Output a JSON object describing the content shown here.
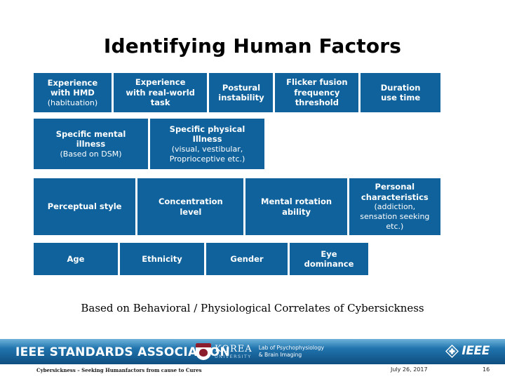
{
  "slide": {
    "title": "Identifying Human Factors",
    "caption": "Based on Behavioral / Physiological Correlates of Cybersickness"
  },
  "diagram": {
    "accent_color": "#0F629B",
    "rows": [
      {
        "id": "row-1",
        "cells": [
          {
            "main": "Experience\nwith HMD",
            "sub": "(habituation)"
          },
          {
            "main": "Experience\nwith real-world\ntask",
            "sub": ""
          },
          {
            "main": "Postural\ninstability",
            "sub": ""
          },
          {
            "main": "Flicker fusion\nfrequency\nthreshold",
            "sub": ""
          },
          {
            "main": "Duration\nuse time",
            "sub": ""
          }
        ]
      },
      {
        "id": "row-2",
        "cells": [
          {
            "main": "Specific mental\nillness",
            "sub": "(Based on DSM)"
          },
          {
            "main": "Specific physical\nIllness",
            "sub": "(visual, vestibular,\nProprioceptive etc.)"
          }
        ]
      },
      {
        "id": "row-3",
        "cells": [
          {
            "main": "Perceptual style",
            "sub": ""
          },
          {
            "main": "Concentration\nlevel",
            "sub": ""
          },
          {
            "main": "Mental rotation\nability",
            "sub": ""
          },
          {
            "main": "Personal\ncharacteristics",
            "sub": "(addiction,\nsensation seeking\netc.)"
          }
        ]
      },
      {
        "id": "row-4",
        "cells": [
          {
            "main": "Age",
            "sub": ""
          },
          {
            "main": "Ethnicity",
            "sub": ""
          },
          {
            "main": "Gender",
            "sub": ""
          },
          {
            "main": "Eye\ndominance",
            "sub": ""
          }
        ]
      }
    ]
  },
  "footer": {
    "ieee_sa_label": "IEEE STANDARDS ASSOCIATION",
    "korea": {
      "name": "KOREA",
      "university": "UNIVERSITY",
      "lab_line1": "Lab of Psychophysiology",
      "lab_line2": "& Brain Imaging"
    },
    "ieee_label": "IEEE"
  },
  "status": {
    "presentation_title": "Cybersickness – Seeking Humanfactors from cause to Cures",
    "date": "July 26, 2017",
    "page": "16"
  }
}
